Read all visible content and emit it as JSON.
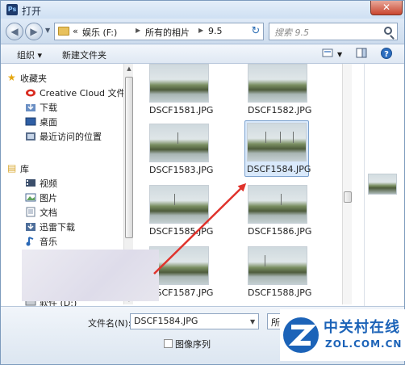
{
  "window": {
    "title": "打开",
    "app_icon": "Ps",
    "close_glyph": "✕"
  },
  "navbar": {
    "back_glyph": "◀",
    "forward_glyph": "▶",
    "breadcrumb": [
      "«",
      "娱乐 (F:)",
      "所有的相片",
      "9.5"
    ],
    "refresh_glyph": "↻",
    "search_placeholder": "搜索 9.5"
  },
  "toolbar": {
    "organize_label": "组织 ▾",
    "new_folder_label": "新建文件夹"
  },
  "sidebar": {
    "favorites_header": "收藏夹",
    "favorites": [
      "Creative Cloud 文件",
      "下载",
      "桌面",
      "最近访问的位置"
    ],
    "library_header": "库",
    "library": [
      "视频",
      "图片",
      "文档",
      "迅雷下载",
      "音乐"
    ],
    "drive": "软件 (D:)"
  },
  "files": [
    {
      "name": "DSCF1581.JPG",
      "selected": false
    },
    {
      "name": "DSCF1582.JPG",
      "selected": false
    },
    {
      "name": "DSCF1583.JPG",
      "selected": false
    },
    {
      "name": "DSCF1584.JPG",
      "selected": true
    },
    {
      "name": "DSCF1585.JPG",
      "selected": false
    },
    {
      "name": "DSCF1586.JPG",
      "selected": false
    },
    {
      "name": "DSCF1587.JPG",
      "selected": false
    },
    {
      "name": "DSCF1588.JPG",
      "selected": false
    }
  ],
  "bottom": {
    "filename_label": "文件名(N):",
    "filename_value": "DSCF1584.JPG",
    "filetype_value": "所有",
    "image_sequence_label": "图像序列"
  },
  "watermark": {
    "title": "中关村在线",
    "subtitle": "ZOL.COM.CN"
  },
  "colors": {
    "accent": "#1c63b8",
    "arrow": "#e0332c",
    "selection": "#d9e9fb"
  }
}
